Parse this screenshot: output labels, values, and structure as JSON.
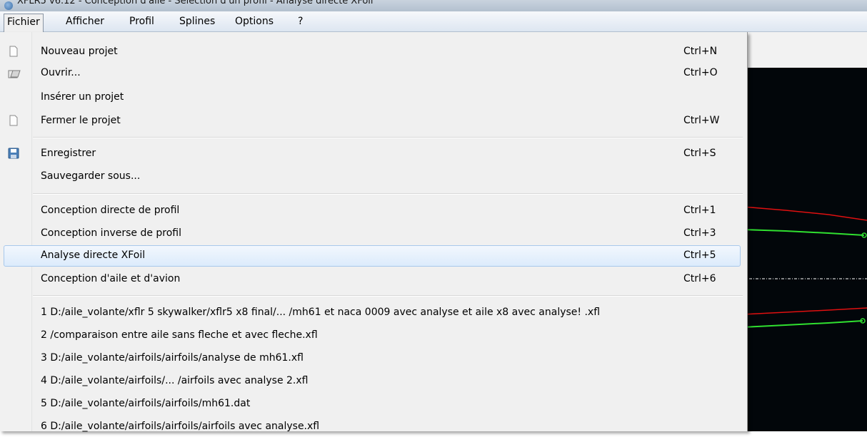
{
  "window": {
    "title": "XFLR5 v6.12 - Conception d'aile - Sélection d'un profil - Analyse directe XFoil"
  },
  "menubar": {
    "items": [
      {
        "label": "Fichier"
      },
      {
        "label": "Afficher"
      },
      {
        "label": "Profil"
      },
      {
        "label": "Splines"
      },
      {
        "label": "Options"
      },
      {
        "label": "?"
      }
    ]
  },
  "file_menu": {
    "items": [
      {
        "label": "Nouveau projet",
        "shortcut": "Ctrl+N",
        "icon": "new-document-icon"
      },
      {
        "label": "Ouvrir...",
        "shortcut": "Ctrl+O",
        "icon": "open-folder-icon"
      },
      {
        "label": "Insérer un projet",
        "shortcut": ""
      },
      {
        "label": "Fermer le projet",
        "shortcut": "Ctrl+W",
        "icon": "close-document-icon"
      },
      {
        "label": "Enregistrer",
        "shortcut": "Ctrl+S",
        "icon": "save-icon"
      },
      {
        "label": "Sauvegarder sous...",
        "shortcut": ""
      },
      {
        "label": "Conception directe de profil",
        "shortcut": "Ctrl+1"
      },
      {
        "label": "Conception inverse de profil",
        "shortcut": "Ctrl+3"
      },
      {
        "label": "Analyse directe XFoil",
        "shortcut": "Ctrl+5",
        "highlighted": true
      },
      {
        "label": "Conception d'aile et d'avion",
        "shortcut": "Ctrl+6"
      }
    ],
    "recent_files": [
      "1 D:/aile_volante/xflr 5 skywalker/xflr5 x8 final/...  /mh61 et naca 0009 avec  analyse et aile  x8 avec analyse! .xfl",
      "2 /comparaison entre aile sans fleche et avec fleche.xfl",
      "3 D:/aile_volante/airfoils/airfoils/analyse de mh61.xfl",
      "4 D:/aile_volante/airfoils/...  /airfoils avec analyse 2.xfl",
      "5 D:/aile_volante/airfoils/airfoils/mh61.dat",
      "6 D:/aile_volante/airfoils/airfoils/airfoils avec analyse.xfl"
    ]
  },
  "canvas": {
    "background": "#02060a",
    "curve_colors": [
      "#e01010",
      "#30e030",
      "#ffffff"
    ]
  }
}
